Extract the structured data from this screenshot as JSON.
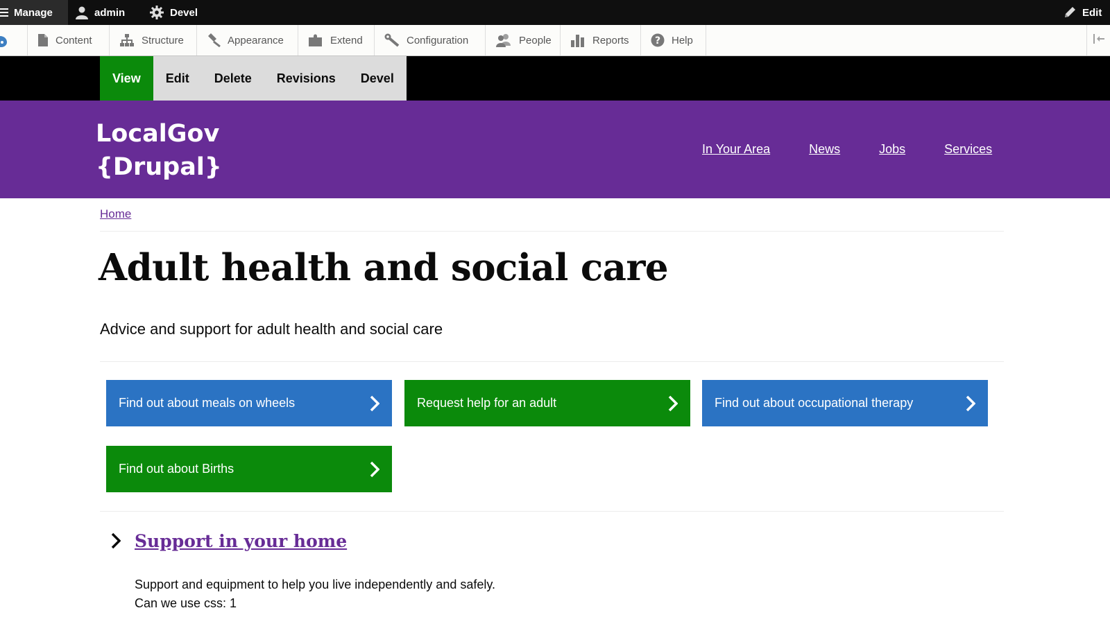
{
  "admin_toolbar": {
    "manage": "Manage",
    "user": "admin",
    "devel": "Devel",
    "edit": "Edit"
  },
  "tray": {
    "items": [
      {
        "label": "Content",
        "icon": "file-icon"
      },
      {
        "label": "Structure",
        "icon": "sitemap-icon"
      },
      {
        "label": "Appearance",
        "icon": "paintbrush-icon"
      },
      {
        "label": "Extend",
        "icon": "puzzle-icon"
      },
      {
        "label": "Configuration",
        "icon": "wrench-icon"
      },
      {
        "label": "People",
        "icon": "people-icon"
      },
      {
        "label": "Reports",
        "icon": "bar-chart-icon"
      },
      {
        "label": "Help",
        "icon": "help-icon"
      }
    ]
  },
  "tasks": [
    "View",
    "Edit",
    "Delete",
    "Revisions",
    "Devel"
  ],
  "site": {
    "name_line1": "LocalGov",
    "name_line2": "{Drupal}"
  },
  "main_nav": [
    "In Your Area",
    "News",
    "Jobs",
    "Services"
  ],
  "breadcrumb": {
    "home": "Home"
  },
  "page": {
    "title": "Adult health and social care",
    "summary": "Advice and support for adult health and social care"
  },
  "ctas": [
    {
      "label": "Find out about meals on wheels",
      "color": "#2b73c3"
    },
    {
      "label": "Request help for an adult",
      "color": "#0b8a0b"
    },
    {
      "label": "Find out about occupational therapy",
      "color": "#2b73c3"
    },
    {
      "label": "Find out about Births",
      "color": "#0b8a0b"
    }
  ],
  "section": {
    "title": "Support in your home",
    "description": "Support and equipment to help you live independently and safely.",
    "extra": "Can we use css: 1"
  },
  "colors": {
    "brand_purple": "#672c96",
    "action_green": "#0b8a0b",
    "action_blue": "#2b73c3"
  }
}
